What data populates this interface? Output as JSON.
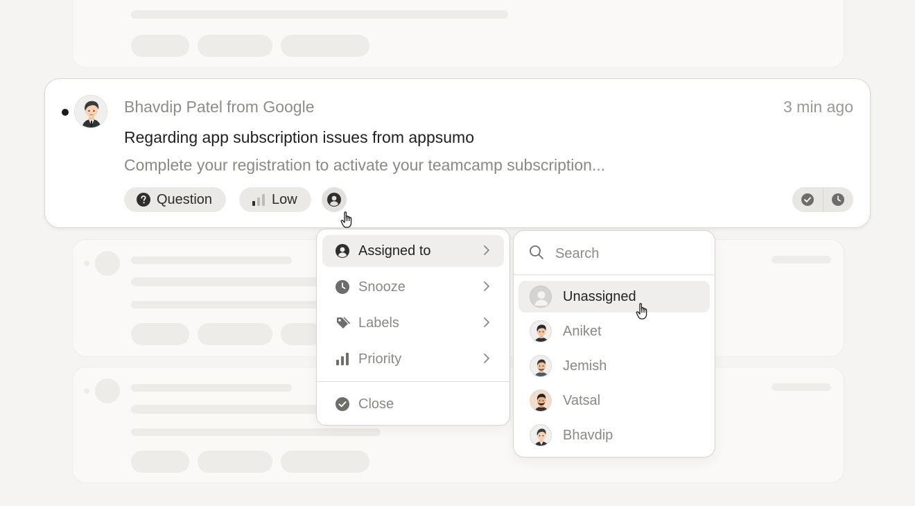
{
  "conversation": {
    "sender_name": "Bhavdip Patel",
    "sender_company": "from Google",
    "time": "3 min ago",
    "subject": "Regarding app subscription issues from appsumo",
    "preview": "Complete your registration to activate your teamcamp subscription...",
    "type_tag": "Question",
    "priority_tag": "Low",
    "unread": true
  },
  "context_menu": {
    "items": [
      {
        "label": "Assigned to",
        "icon": "user-circle-icon",
        "submenu": true,
        "active": true
      },
      {
        "label": "Snooze",
        "icon": "clock-icon",
        "submenu": true
      },
      {
        "label": "Labels",
        "icon": "tag-icon",
        "submenu": true
      },
      {
        "label": "Priority",
        "icon": "bar-chart-icon",
        "submenu": true
      }
    ],
    "close_label": "Close"
  },
  "assignee_menu": {
    "search_placeholder": "Search",
    "people": [
      {
        "name": "Unassigned",
        "active": true
      },
      {
        "name": "Aniket"
      },
      {
        "name": "Jemish"
      },
      {
        "name": "Vatsal"
      },
      {
        "name": "Bhavdip"
      }
    ]
  },
  "colors": {
    "background": "#f5f4f2",
    "card": "#ffffff",
    "tag_bg": "#ebe9e6",
    "icon_gray": "#6f6d6a",
    "text_dark": "#1f1f1f",
    "text_muted": "#8b8985"
  }
}
